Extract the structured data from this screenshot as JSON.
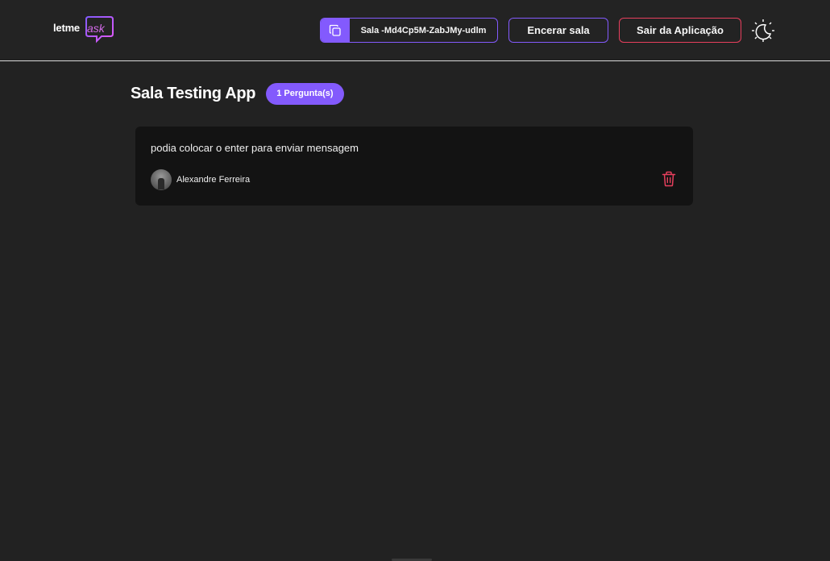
{
  "header": {
    "logo": {
      "word_letme": "letme",
      "word_ask": "ask"
    },
    "room_code": {
      "label": "Sala -Md4Cp5M-ZabJMy-udlm",
      "icon": "copy-icon"
    },
    "close_room_label": "Encerar sala",
    "exit_label": "Sair da Aplicação",
    "theme_icon": "moon-sun-icon"
  },
  "room": {
    "title": "Sala Testing App",
    "question_count": "1 Pergunta(s)"
  },
  "questions": [
    {
      "content": "podia colocar o enter para enviar mensagem",
      "author": "Alexandre Ferreira",
      "delete_icon": "trash-icon"
    }
  ],
  "colors": {
    "background": "#222222",
    "accent": "#835afd",
    "danger": "#e73f5d",
    "card": "#131313",
    "logo_pink": "#d36ae8"
  }
}
